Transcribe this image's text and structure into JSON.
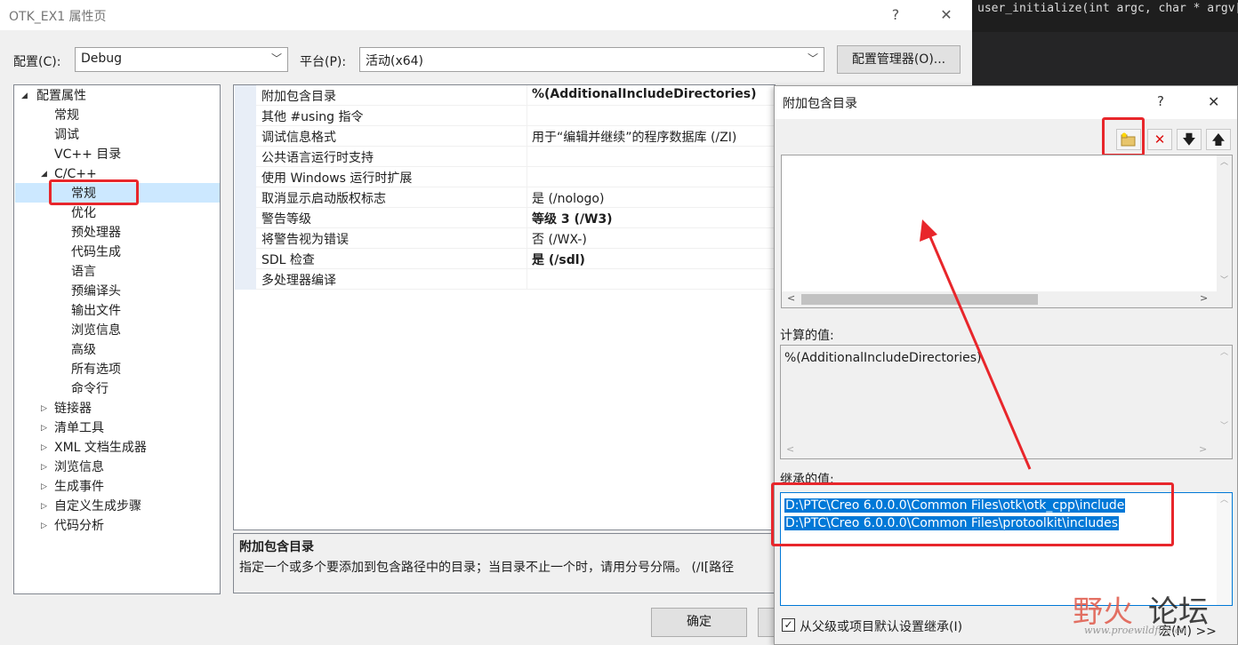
{
  "window": {
    "title": "OTK_EX1 属性页",
    "help": "?",
    "close": "✕"
  },
  "code_editor": {
    "text": "user_initialize(int argc, char * argv[], char"
  },
  "config": {
    "config_label": "配置(C):",
    "config_value": "Debug",
    "platform_label": "平台(P):",
    "platform_value": "活动(x64)",
    "manager_button": "配置管理器(O)..."
  },
  "tree": {
    "root": "配置属性",
    "items": [
      "常规",
      "调试",
      "VC++ 目录",
      "C/C++",
      "常规",
      "优化",
      "预处理器",
      "代码生成",
      "语言",
      "预编译头",
      "输出文件",
      "浏览信息",
      "高级",
      "所有选项",
      "命令行",
      "链接器",
      "清单工具",
      "XML 文档生成器",
      "浏览信息",
      "生成事件",
      "自定义生成步骤",
      "代码分析"
    ]
  },
  "grid": {
    "rows": [
      {
        "name": "附加包含目录",
        "value": "%(AdditionalIncludeDirectories)"
      },
      {
        "name": "其他 #using 指令",
        "value": ""
      },
      {
        "name": "调试信息格式",
        "value": "用于“编辑并继续”的程序数据库 (/ZI)"
      },
      {
        "name": "公共语言运行时支持",
        "value": ""
      },
      {
        "name": "使用 Windows 运行时扩展",
        "value": ""
      },
      {
        "name": "取消显示启动版权标志",
        "value": "是 (/nologo)"
      },
      {
        "name": "警告等级",
        "value": "等级 3 (/W3)"
      },
      {
        "name": "将警告视为错误",
        "value": "否 (/WX-)"
      },
      {
        "name": "SDL 检查",
        "value": "是 (/sdl)"
      },
      {
        "name": "多处理器编译",
        "value": ""
      }
    ]
  },
  "description": {
    "title": "附加包含目录",
    "text": "指定一个或多个要添加到包含路径中的目录；当目录不止一个时，请用分号分隔。     (/I[路径"
  },
  "ok_button": "确定",
  "dialog": {
    "title": "附加包含目录",
    "help": "?",
    "close": "✕",
    "computed_label": "计算的值:",
    "computed_value": "%(AdditionalIncludeDirectories)",
    "inherited_label": "继承的值:",
    "inherited_values": [
      "D:\\PTC\\Creo 6.0.0.0\\Common Files\\otk\\otk_cpp\\include",
      "D:\\PTC\\Creo 6.0.0.0\\Common Files\\protoolkit\\includes"
    ],
    "inherit_checkbox": "从父级或项目默认设置继承(I)",
    "macro_button": "宏(M) >>"
  },
  "watermark": {
    "text1": "野火",
    "text2": "论坛",
    "url": "www.proewildfire.cn"
  },
  "colors": {
    "accent": "#0078d7",
    "annotation_red": "#e8262b",
    "selection": "#cce8ff"
  }
}
